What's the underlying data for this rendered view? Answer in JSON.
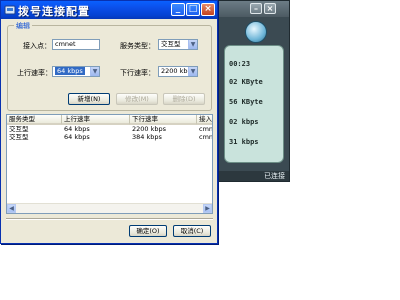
{
  "background_window": {
    "timer": "00:23",
    "rows": [
      "02 KByte",
      "56 KByte",
      "02 kbps",
      "31 kbps"
    ],
    "status": "已连接"
  },
  "dialog": {
    "title": "拨号连接配置",
    "group_label": "编辑",
    "access_point_label": "接入点：",
    "access_point_value": "cmnet",
    "service_type_label": "服务类型：",
    "service_type_value": "交互型",
    "upload_rate_label": "上行速率：",
    "upload_rate_value": "64 kbps",
    "download_rate_label": "下行速率：",
    "download_rate_value": "2200 kbps",
    "add_button": "新增(N)",
    "modify_button": "修改(M)",
    "delete_button": "删除(D)",
    "table": {
      "headers": [
        "服务类型",
        "上行速率",
        "下行速率",
        "接入点"
      ],
      "rows": [
        [
          "交互型",
          "64 kbps",
          "2200 kbps",
          "cmnet"
        ],
        [
          "交互型",
          "64 kbps",
          "384 kbps",
          "cmnet"
        ]
      ]
    },
    "ok_button": "确定(O)",
    "cancel_button": "取消(C)"
  },
  "colors": {
    "titlebar": "#0542d2",
    "dialog_bg": "#ece9d8",
    "group_label": "#0046d5",
    "background_panel": "#c9e3dc"
  },
  "icons": [
    "dialer-app-icon",
    "minimize-icon",
    "maximize-icon",
    "close-icon",
    "search-icon",
    "dropdown-arrow-icon",
    "scroll-left-icon",
    "scroll-right-icon"
  ]
}
